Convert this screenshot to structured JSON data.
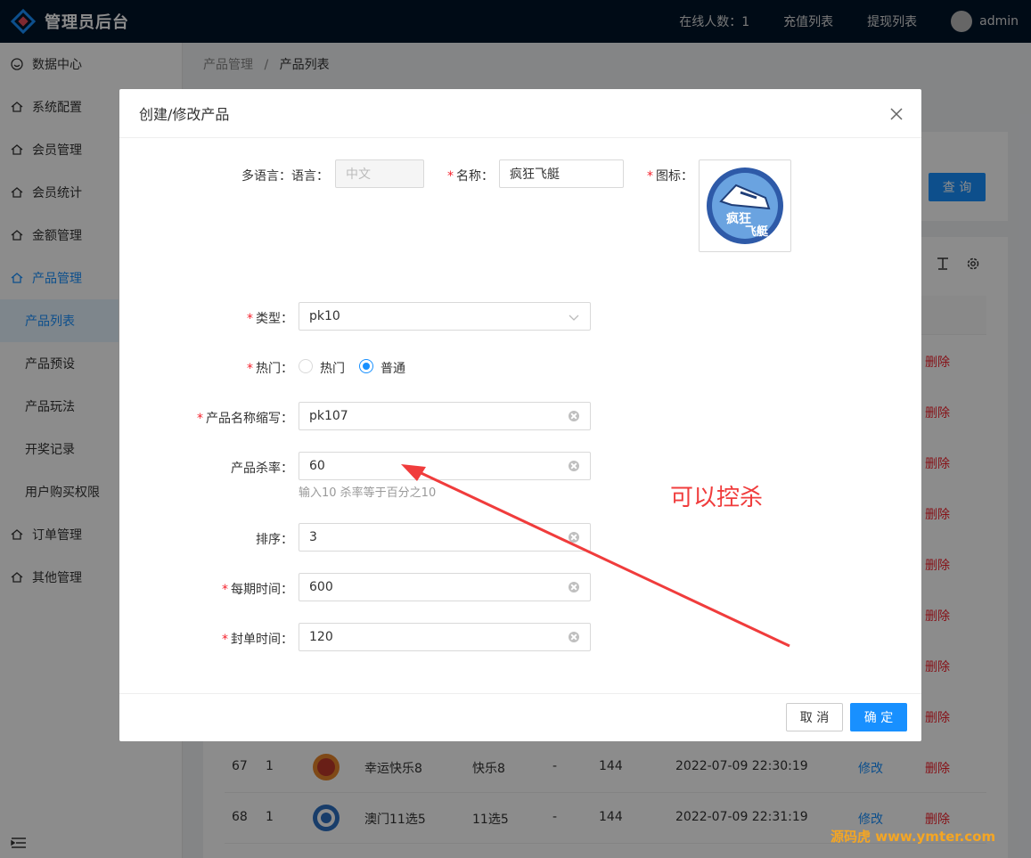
{
  "app": {
    "title": "管理员后台"
  },
  "topnav": {
    "online": "在线人数：1",
    "recharge": "充值列表",
    "withdraw": "提现列表",
    "user": "admin"
  },
  "sidebar": {
    "items": [
      {
        "label": "数据中心"
      },
      {
        "label": "系统配置"
      },
      {
        "label": "会员管理"
      },
      {
        "label": "会员统计"
      },
      {
        "label": "金额管理"
      },
      {
        "label": "产品管理"
      }
    ],
    "subitems": [
      {
        "label": "产品列表"
      },
      {
        "label": "产品预设"
      },
      {
        "label": "产品玩法"
      },
      {
        "label": "开奖记录"
      },
      {
        "label": "用户购买权限"
      }
    ],
    "items_after": [
      {
        "label": "订单管理"
      },
      {
        "label": "其他管理"
      }
    ]
  },
  "breadcrumb": {
    "parent": "产品管理",
    "sep": "/",
    "current": "产品列表"
  },
  "search": {
    "query_label": "查 询"
  },
  "table": {
    "delete_label": "删除",
    "edit_label": "修改",
    "rows": [
      {
        "id": "67",
        "sort": "1",
        "name": "幸运快乐8",
        "type": "快乐8",
        "dash": "-",
        "period": "144",
        "time": "2022-07-09 22:30:19"
      },
      {
        "id": "68",
        "sort": "1",
        "name": "澳门11选5",
        "type": "11选5",
        "dash": "-",
        "period": "144",
        "time": "2022-07-09 22:31:19"
      }
    ]
  },
  "modal": {
    "title": "创建/修改产品",
    "lang_label": "多语言：语言：",
    "lang_value": "中文",
    "name_label": "名称：",
    "name_value": "疯狂飞艇",
    "icon_label": "图标：",
    "icon_text_top": "疯狂",
    "icon_text_bottom": "飞艇",
    "type_label": "类型：",
    "type_value": "pk10",
    "hot_label": "热门：",
    "hot_opt1": "热门",
    "hot_opt2": "普通",
    "abbr_label": "产品名称缩写：",
    "abbr_value": "pk107",
    "kill_label": "产品杀率：",
    "kill_value": "60",
    "kill_hint": "输入10 杀率等于百分之10",
    "sort_label": "排序：",
    "sort_value": "3",
    "period_label": "每期时间：",
    "period_value": "600",
    "close_label": "封单时间：",
    "close_value": "120",
    "cancel": "取 消",
    "ok": "确 定"
  },
  "annotation": {
    "text": "可以控杀"
  },
  "watermark": {
    "text": "源码虎 www.ymter.com"
  },
  "colors": {
    "primary": "#1890ff",
    "danger": "#f5222d",
    "header": "#001529",
    "annotation": "#f03c3c"
  }
}
